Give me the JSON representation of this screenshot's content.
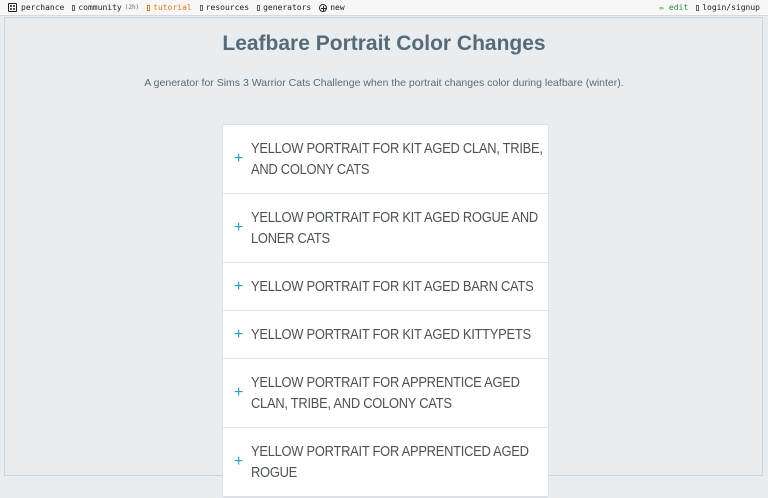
{
  "topbar": {
    "brand": "perchance",
    "community": "community",
    "community_count": "(2h)",
    "tutorial": "tutorial",
    "resources": "resources",
    "generators": "generators",
    "new": "new",
    "edit": "✏ edit",
    "login": "login/signup"
  },
  "page": {
    "title": "Leafbare Portrait Color Changes",
    "description": "A generator for Sims 3 Warrior Cats Challenge when the portrait changes color during leafbare (winter)."
  },
  "accordion": {
    "items": [
      {
        "label": "Yellow Portrait for Kit aged Clan, Tribe, and Colony Cats"
      },
      {
        "label": "Yellow Portrait for Kit aged Rogue and Loner Cats"
      },
      {
        "label": "Yellow Portrait for Kit aged Barn Cats"
      },
      {
        "label": "Yellow Portrait for Kit aged Kittypets"
      },
      {
        "label": "Yellow Portrait for Apprentice aged Clan, Tribe, and Colony Cats"
      },
      {
        "label": "Yellow Portrait for Apprenticed aged Rogue"
      }
    ]
  }
}
